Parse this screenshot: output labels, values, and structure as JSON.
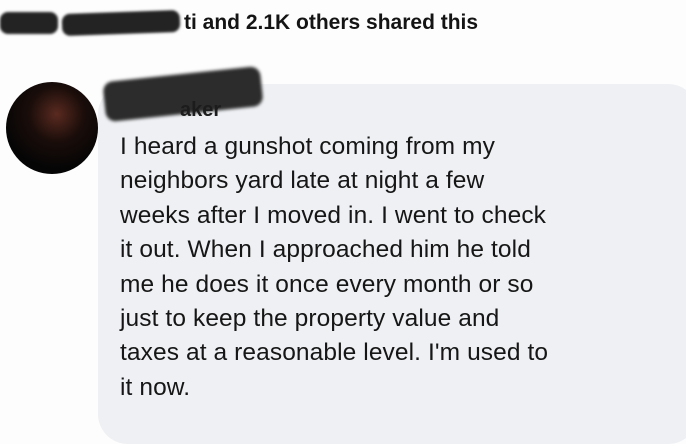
{
  "header": {
    "shared_text": "ti and 2.1K others shared this"
  },
  "comment": {
    "author_suffix": "aker",
    "lines": [
      "I heard a gunshot coming from my",
      "neighbors yard late at night a few",
      "weeks after I moved in. I went to check",
      "it out. When I approached him he told",
      "me he does it once every month or so",
      "just to keep the property value and",
      "taxes at a reasonable level. I'm used to",
      "it now."
    ]
  },
  "colors": {
    "bubble": "#eef0f3",
    "text": "#161616",
    "redaction": "#232323"
  }
}
